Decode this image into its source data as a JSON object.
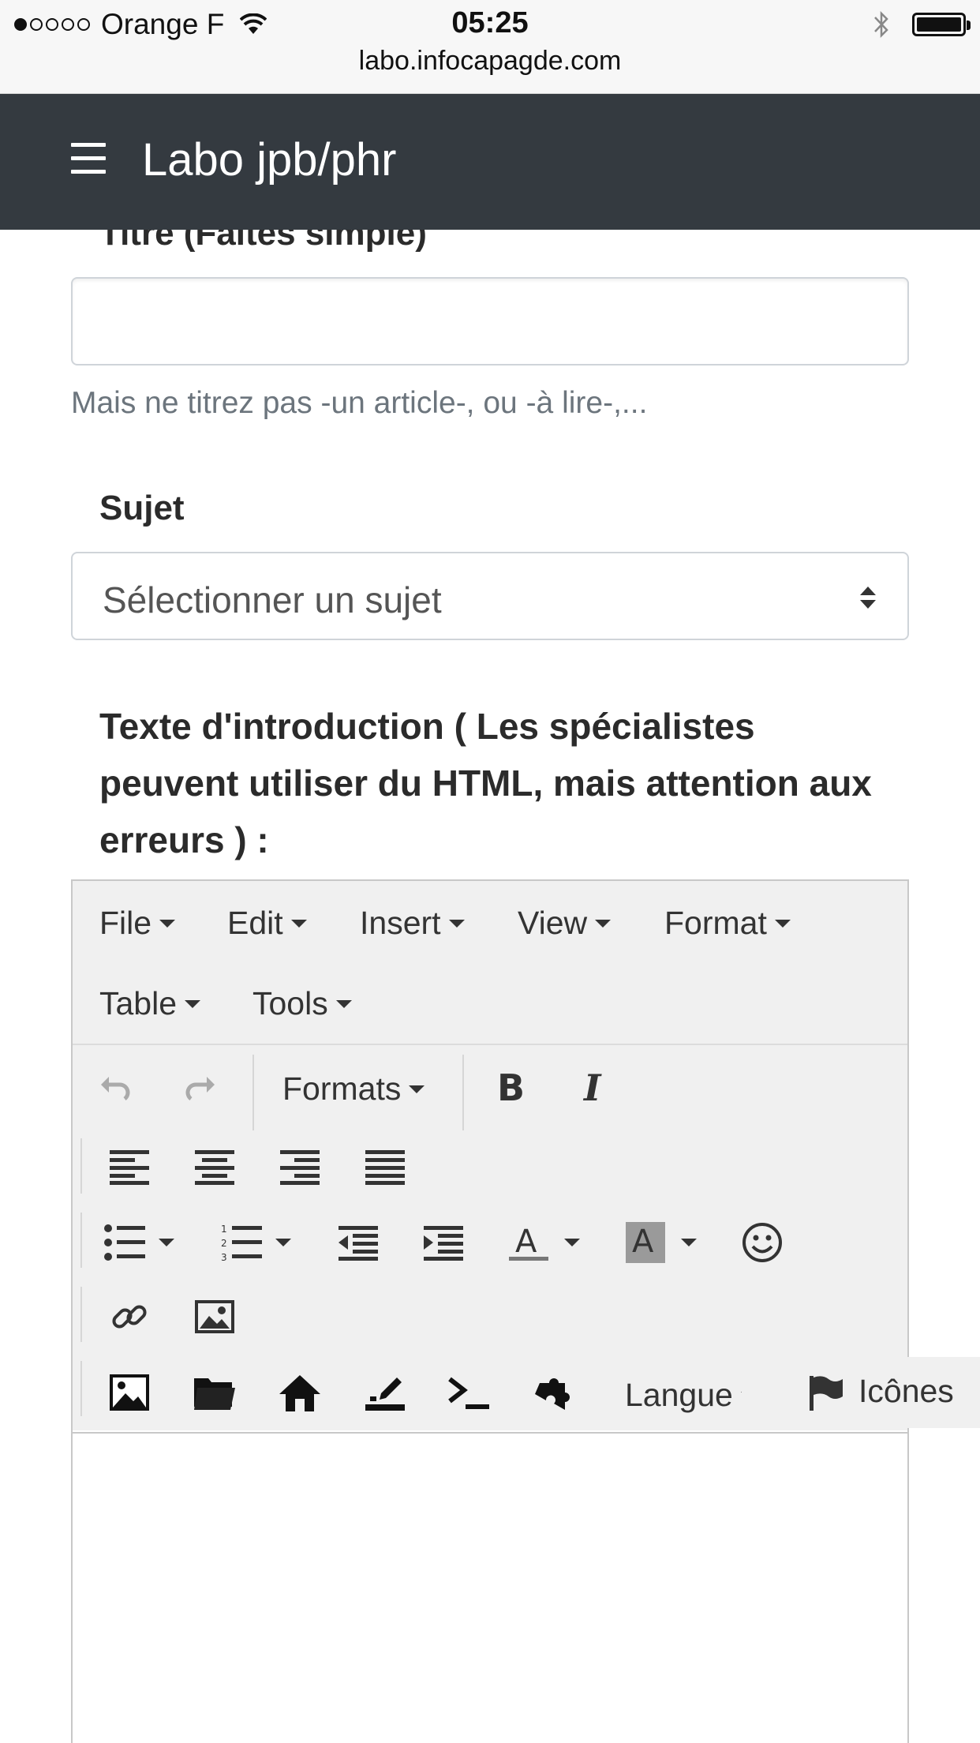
{
  "status_bar": {
    "carrier": "Orange F",
    "time": "05:25",
    "url": "labo.infocapagde.com"
  },
  "navbar": {
    "brand": "Labo jpb/phr",
    "menu_icon": "hamburger-icon"
  },
  "form": {
    "title_label": "Titre (Faites simple)",
    "title_value": "",
    "title_help": "Mais ne titrez pas -un article-, ou -à lire-,...",
    "subject_label": "Sujet",
    "subject_selected": "Sélectionner un sujet",
    "intro_label": "Texte d'introduction ( Les spécialistes peuvent utiliser du HTML, mais attention aux erreurs ) :"
  },
  "editor": {
    "menu": [
      "File",
      "Edit",
      "Insert",
      "View",
      "Format",
      "Table",
      "Tools"
    ],
    "formats_label": "Formats",
    "langue_label": "Langue",
    "icones_label": "Icônes",
    "icons": {
      "row1": [
        "undo-icon",
        "redo-icon",
        "bold-icon",
        "italic-icon"
      ],
      "row2": [
        "align-left-icon",
        "align-center-icon",
        "align-right-icon",
        "align-justify-icon"
      ],
      "row3": [
        "bullet-list-icon",
        "numbered-list-icon",
        "outdent-icon",
        "indent-icon",
        "text-color-icon",
        "background-color-icon",
        "emoticon-icon"
      ],
      "row4": [
        "link-icon",
        "image-icon"
      ],
      "row5": [
        "picture-icon",
        "folder-icon",
        "home-icon",
        "upload-icon",
        "terminal-icon",
        "puzzle-icon",
        "flag-icon"
      ]
    },
    "body_text": ""
  }
}
